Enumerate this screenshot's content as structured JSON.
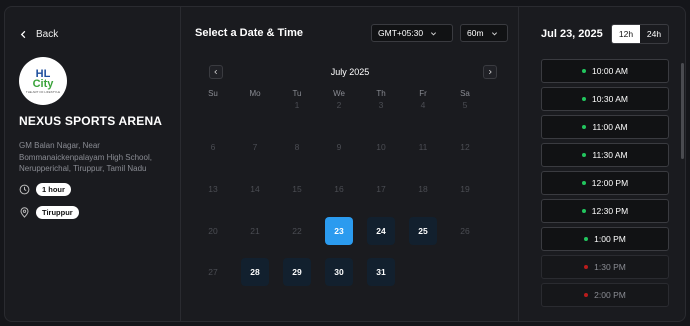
{
  "venue": {
    "back_label": "Back",
    "logo_text": [
      "HL",
      "City",
      "THE ART OF LIFESTYLE"
    ],
    "name": "NEXUS SPORTS ARENA",
    "address": "GM Balan Nagar, Near Bommanaickenpalayam High School, Nerupperichal, Tiruppur, Tamil Nadu",
    "duration": "1 hour",
    "city": "Tiruppur"
  },
  "scheduler": {
    "title": "Select a Date & Time",
    "timezone": "GMT+05:30",
    "slot_length": "60m",
    "month_label": "July 2025",
    "weekdays": [
      "Su",
      "Mo",
      "Tu",
      "We",
      "Th",
      "Fr",
      "Sa"
    ],
    "weeks": [
      [
        null,
        null,
        {
          "d": "1",
          "s": "dim"
        },
        {
          "d": "2",
          "s": "dim"
        },
        {
          "d": "3",
          "s": "dim"
        },
        {
          "d": "4",
          "s": "dim"
        },
        {
          "d": "5",
          "s": "dim"
        }
      ],
      [
        {
          "d": "6",
          "s": "dim"
        },
        {
          "d": "7",
          "s": "dim"
        },
        {
          "d": "8",
          "s": "dim"
        },
        {
          "d": "9",
          "s": "dim"
        },
        {
          "d": "10",
          "s": "dim"
        },
        {
          "d": "11",
          "s": "dim"
        },
        {
          "d": "12",
          "s": "dim"
        }
      ],
      [
        {
          "d": "13",
          "s": "dim"
        },
        {
          "d": "14",
          "s": "dim"
        },
        {
          "d": "15",
          "s": "dim"
        },
        {
          "d": "16",
          "s": "dim"
        },
        {
          "d": "17",
          "s": "dim"
        },
        {
          "d": "18",
          "s": "dim"
        },
        {
          "d": "19",
          "s": "dim"
        }
      ],
      [
        {
          "d": "20",
          "s": "dim"
        },
        {
          "d": "21",
          "s": "dim"
        },
        {
          "d": "22",
          "s": "dim"
        },
        {
          "d": "23",
          "s": "selected"
        },
        {
          "d": "24",
          "s": "avail"
        },
        {
          "d": "25",
          "s": "avail"
        },
        {
          "d": "26",
          "s": "dim"
        }
      ],
      [
        {
          "d": "27",
          "s": "dim"
        },
        {
          "d": "28",
          "s": "avail"
        },
        {
          "d": "29",
          "s": "avail"
        },
        {
          "d": "30",
          "s": "avail"
        },
        {
          "d": "31",
          "s": "avail"
        },
        null,
        null
      ]
    ]
  },
  "times": {
    "selected_date": "Jul 23, 2025",
    "format_12": "12h",
    "format_24": "24h",
    "active_format": "12h",
    "slots": [
      {
        "time": "10:00 AM",
        "available": true
      },
      {
        "time": "10:30 AM",
        "available": true
      },
      {
        "time": "11:00 AM",
        "available": true
      },
      {
        "time": "11:30 AM",
        "available": true
      },
      {
        "time": "12:00 PM",
        "available": true
      },
      {
        "time": "12:30 PM",
        "available": true
      },
      {
        "time": "1:00 PM",
        "available": true
      },
      {
        "time": "1:30 PM",
        "available": false
      },
      {
        "time": "2:00 PM",
        "available": false
      }
    ]
  },
  "colors": {
    "available_dot": "#22c55e",
    "unavailable_dot": "#b91c1c",
    "selected_day": "#2b9bef",
    "available_day": "#12202e"
  }
}
